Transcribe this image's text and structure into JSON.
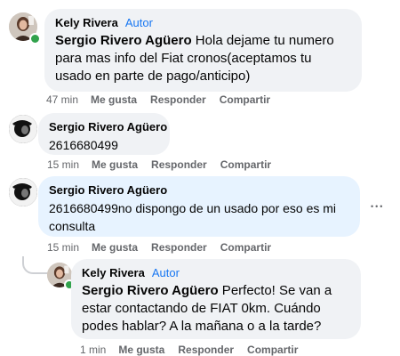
{
  "comments": [
    {
      "author": "Kely Rivera",
      "badge": "Autor",
      "mention": "Sergio Rivero Agüero",
      "text": " Hola dejame tu numero para mas info del Fiat cronos(aceptamos tu usado en parte de pago/anticipo)",
      "time": "47 min",
      "like": "Me gusta",
      "reply": "Responder",
      "share": "Compartir"
    },
    {
      "author": "Sergio Rivero Agüero",
      "text": "2616680499",
      "time": "15 min",
      "like": "Me gusta",
      "reply": "Responder",
      "share": "Compartir"
    },
    {
      "author": "Sergio Rivero Agüero",
      "text": "2616680499no dispongo de un usado por eso es mi consulta",
      "time": "15 min",
      "like": "Me gusta",
      "reply": "Responder",
      "share": "Compartir",
      "more": "•••"
    },
    {
      "author": "Kely Rivera",
      "badge": "Autor",
      "mention": "Sergio Rivero Agüero",
      "text": " Perfecto! Se van a estar contactando de FIAT 0km. Cuándo podes hablar? A la mañana o a la tarde?",
      "time": "1 min",
      "like": "Me gusta",
      "reply": "Responder",
      "share": "Compartir"
    }
  ],
  "colors": {
    "bubble": "#f0f2f5",
    "bubble_highlight": "#e7f3ff",
    "author_badge": "#1877f2",
    "online": "#31a24c",
    "muted": "#65676b"
  },
  "icons": [
    "avatar-kely-rivera",
    "avatar-sergio-rivero",
    "more-options-icon",
    "online-status-icon"
  ]
}
